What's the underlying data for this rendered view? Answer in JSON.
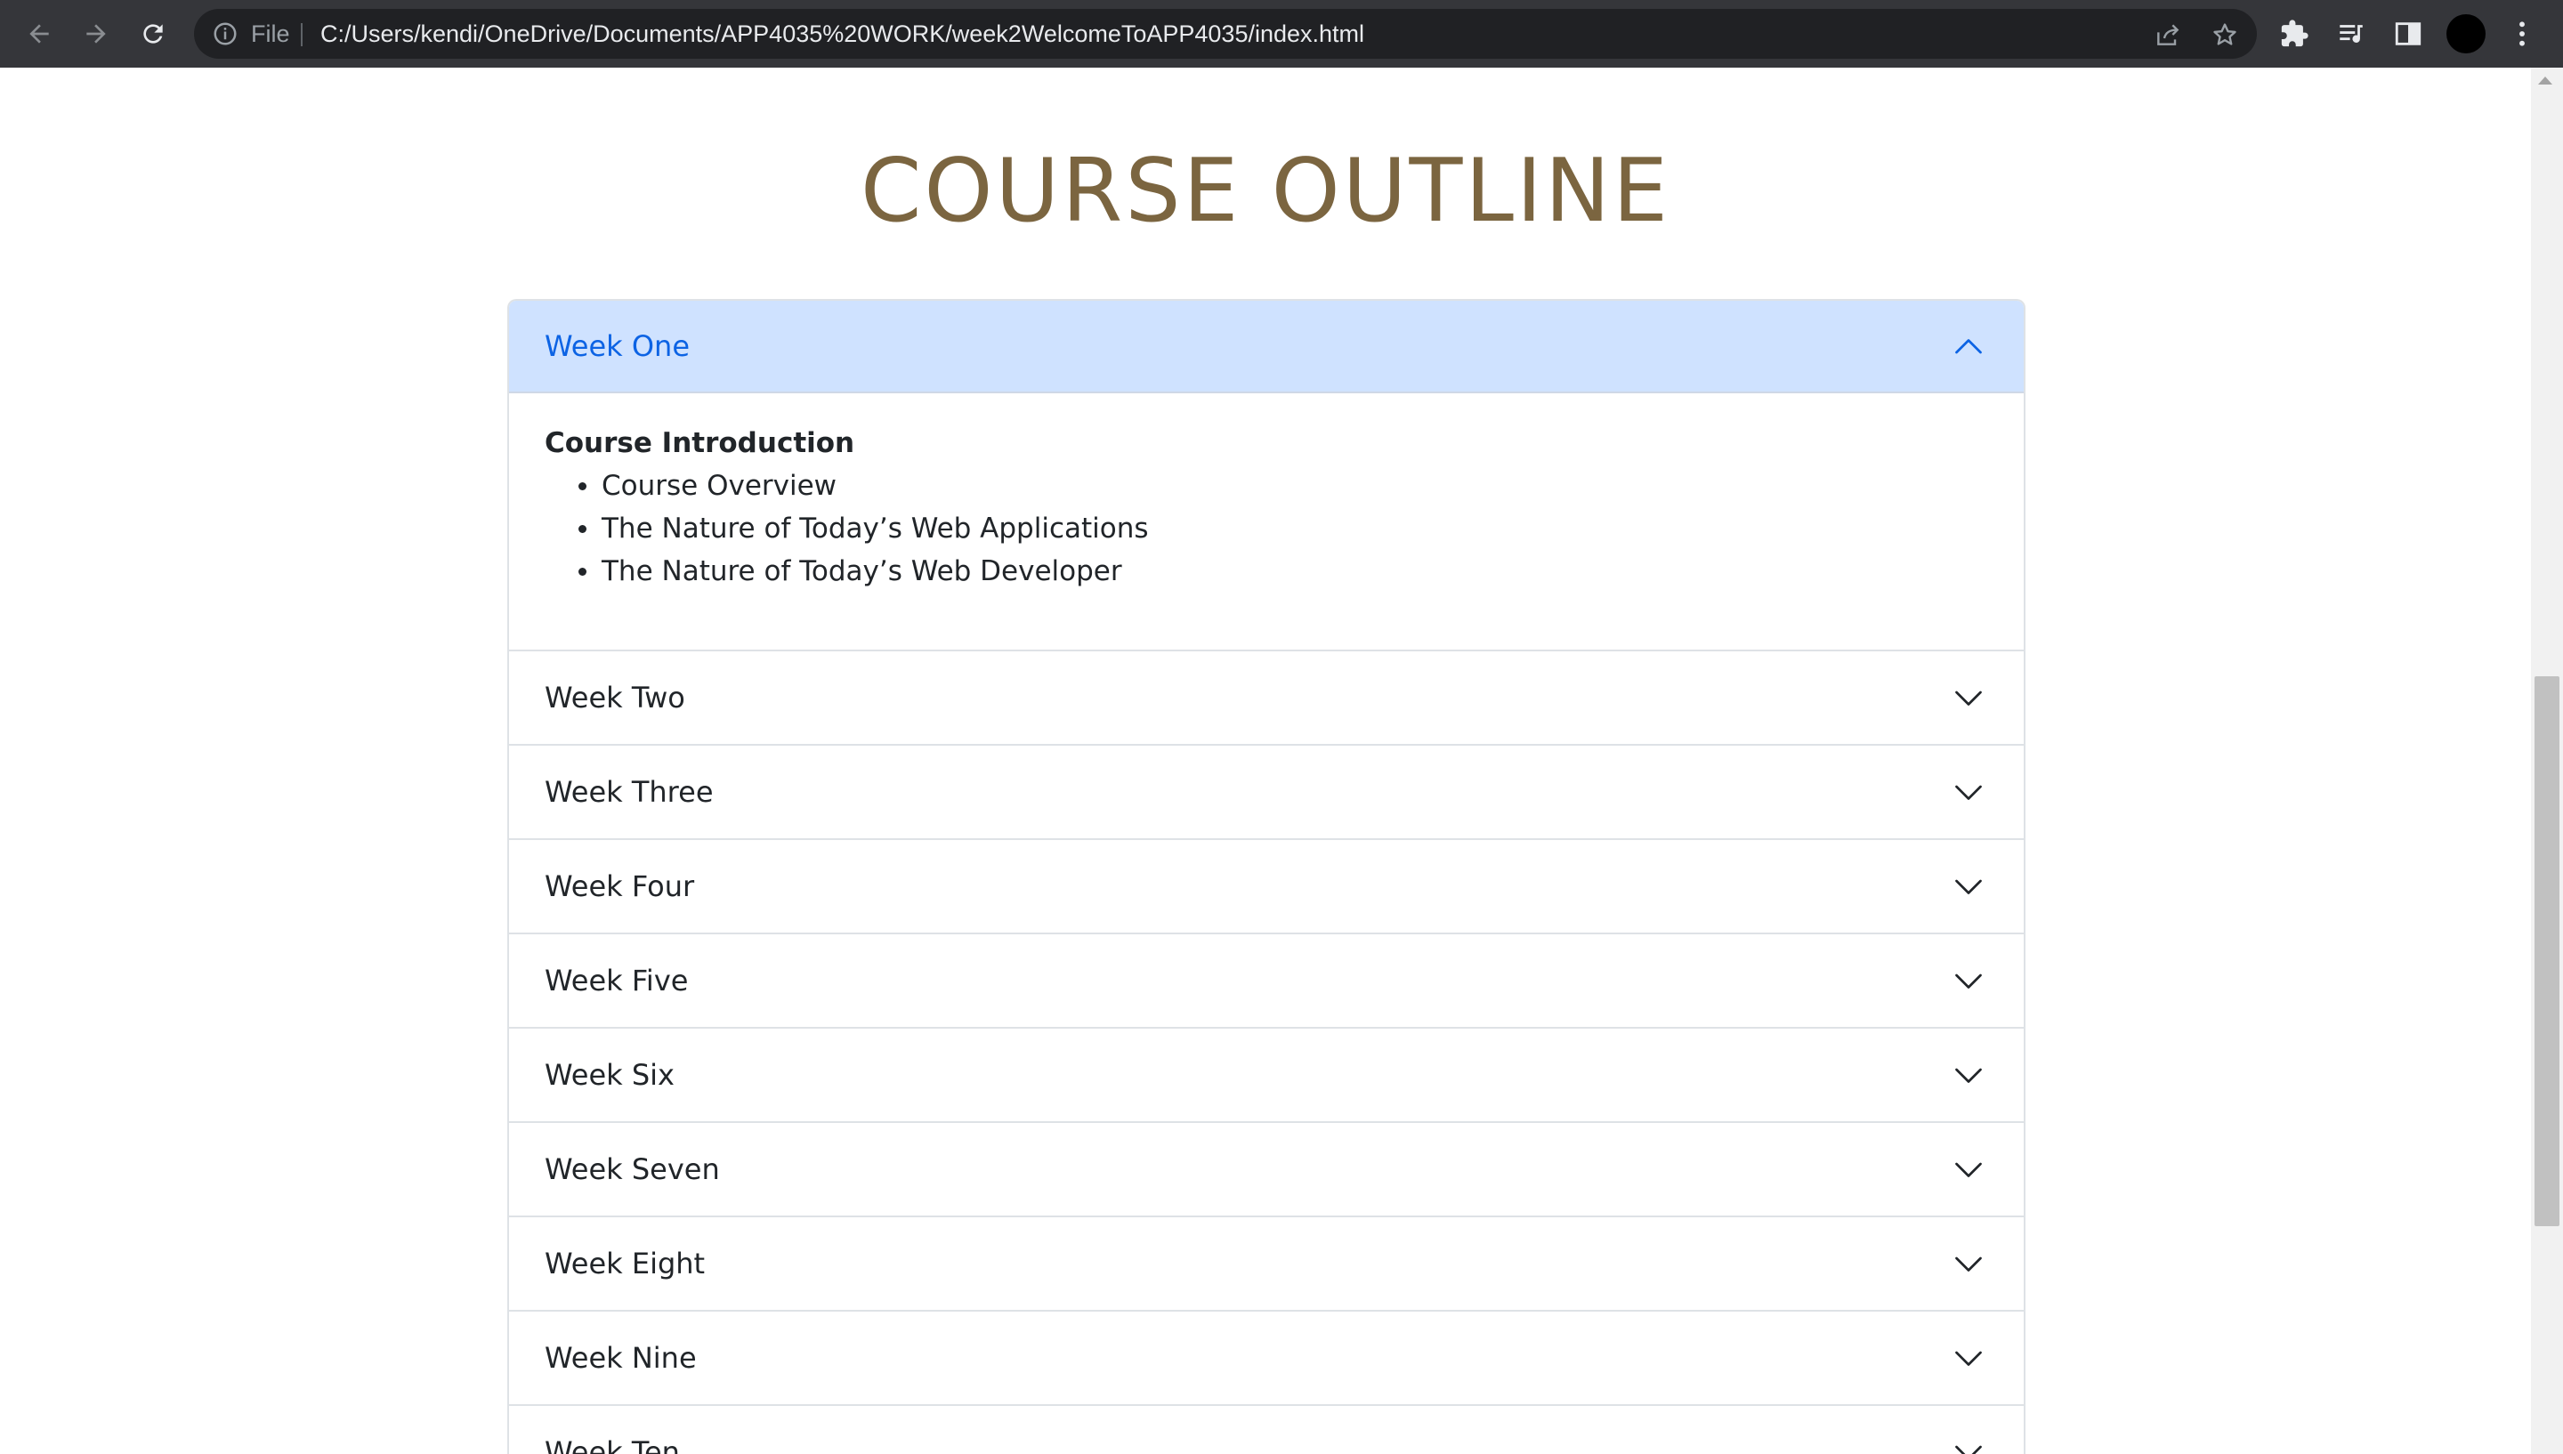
{
  "browser": {
    "scheme_label": "File",
    "url": "C:/Users/kendi/OneDrive/Documents/APP4035%20WORK/week2WelcomeToAPP4035/index.html",
    "icons": [
      "back-arrow-icon",
      "forward-arrow-icon",
      "reload-icon",
      "info-icon",
      "share-icon",
      "star-icon",
      "extensions-icon",
      "media-control-icon",
      "side-panel-icon",
      "profile-avatar",
      "more-menu-icon"
    ]
  },
  "page": {
    "title": "COURSE OUTLINE"
  },
  "accordion": {
    "items": [
      {
        "label": "Week One",
        "expanded": true,
        "body": {
          "heading": "Course Introduction",
          "bullets": [
            "Course Overview",
            "The Nature of Today’s Web Applications",
            "The Nature of Today’s Web Developer"
          ]
        }
      },
      {
        "label": "Week Two",
        "expanded": false
      },
      {
        "label": "Week Three",
        "expanded": false
      },
      {
        "label": "Week Four",
        "expanded": false
      },
      {
        "label": "Week Five",
        "expanded": false
      },
      {
        "label": "Week Six",
        "expanded": false
      },
      {
        "label": "Week Seven",
        "expanded": false
      },
      {
        "label": "Week Eight",
        "expanded": false
      },
      {
        "label": "Week Nine",
        "expanded": false
      },
      {
        "label": "Week Ten",
        "expanded": false
      }
    ]
  },
  "colors": {
    "title": "#7b6540",
    "active_header_bg": "#cfe2ff",
    "active_header_text": "#0c63e4",
    "chrome_bg": "#35363a",
    "omnibox_bg": "#202124"
  }
}
